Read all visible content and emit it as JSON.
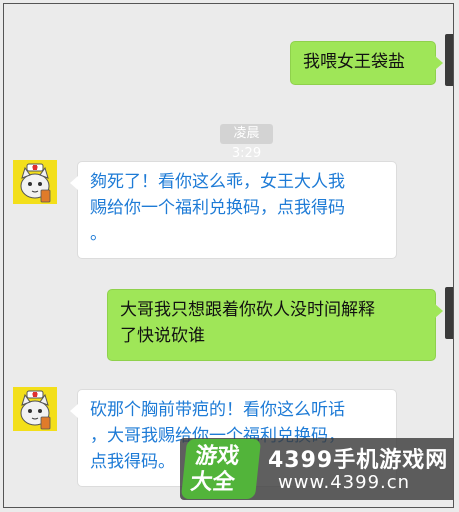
{
  "timestamp": "凌晨3:29",
  "messages": [
    {
      "side": "out",
      "text": "我喂女王袋盐"
    },
    {
      "side": "in",
      "text": "夠死了！看你这么乖，女王大人我赐给你一个福利兑换码，点我得码。",
      "lines": [
        "夠死了！看你这么乖，女王大人我",
        "赐给你一个福利兑换码，点我得码",
        "。"
      ]
    },
    {
      "side": "out",
      "text": "大哥我只想跟着你砍人没时间解释了快说砍谁",
      "lines": [
        "大哥我只想跟着你砍人没时间解释",
        "了快说砍谁"
      ]
    },
    {
      "side": "in",
      "text": "砍那个胸前带疤的！看你这么听话，大哥我赐给你一个福利兑换码，点我得码。",
      "lines": [
        "砍那个胸前带疤的！看你这么听话",
        "，大哥我赐给你一个福利兑换码，",
        "点我得码。"
      ]
    }
  ],
  "watermark": {
    "logo_top": "游戏",
    "logo_bottom": "大全",
    "site_name": "4399手机游戏网",
    "url": "www.4399.cn",
    "logo_color": "#52b43a"
  },
  "colors": {
    "outgoing_bubble": "#9fe658",
    "incoming_bubble": "#ffffff",
    "incoming_text": "#1e7bd6",
    "background": "#ebebeb",
    "avatar_bg": "#f3df1a"
  },
  "avatar_icon": "cat-nurse-avatar-icon"
}
